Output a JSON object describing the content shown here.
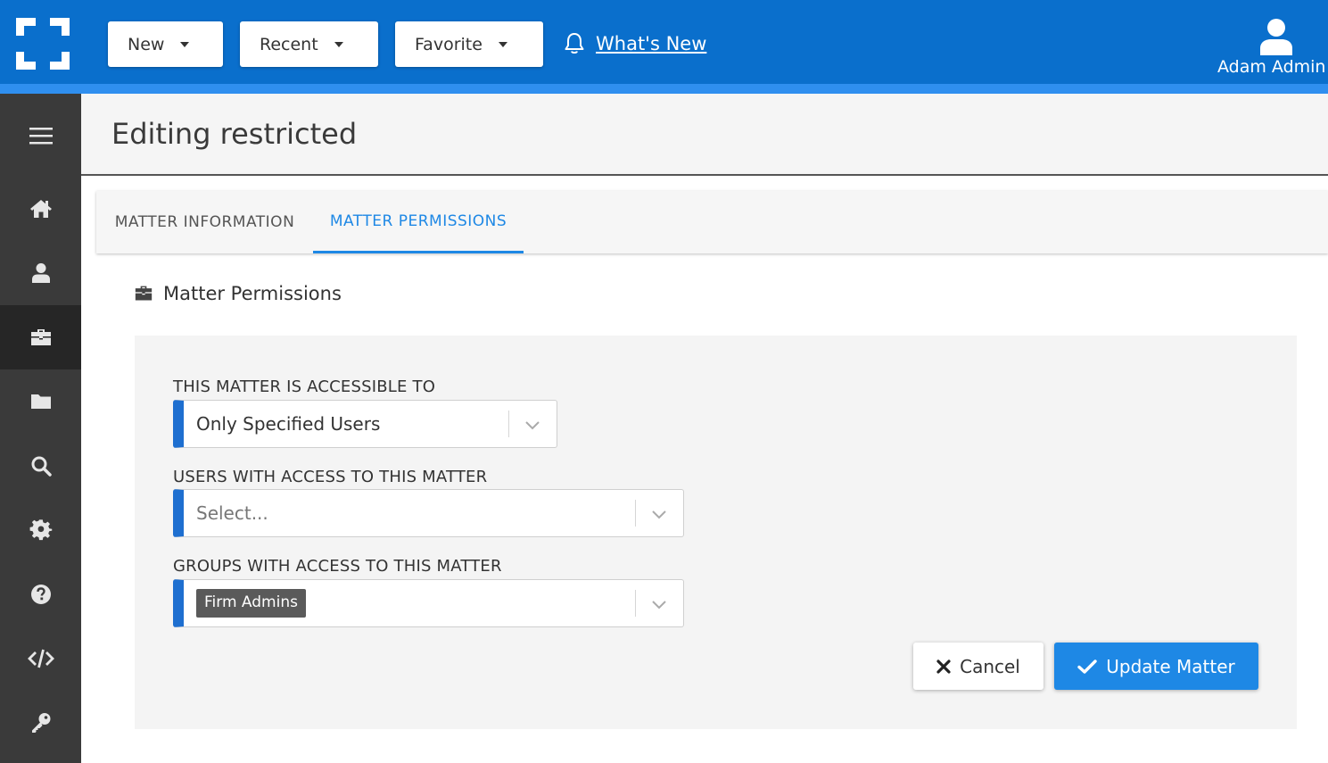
{
  "header": {
    "nav": [
      {
        "label": "New"
      },
      {
        "label": "Recent"
      },
      {
        "label": "Favorite"
      }
    ],
    "whats_new": "What's New",
    "user_name": "Adam Admin"
  },
  "sidebar": {
    "items": [
      {
        "icon": "hamburger-menu-icon"
      },
      {
        "icon": "home-icon"
      },
      {
        "icon": "user-icon"
      },
      {
        "icon": "briefcase-icon",
        "active": true
      },
      {
        "icon": "folder-icon"
      },
      {
        "icon": "search-icon"
      },
      {
        "icon": "gear-icon"
      },
      {
        "icon": "question-circle-icon"
      },
      {
        "icon": "code-icon"
      },
      {
        "icon": "key-icon"
      }
    ]
  },
  "page": {
    "title": "Editing restricted"
  },
  "tabs": [
    {
      "label": "MATTER INFORMATION",
      "active": false
    },
    {
      "label": "MATTER PERMISSIONS",
      "active": true
    }
  ],
  "section": {
    "title": "Matter Permissions"
  },
  "form": {
    "accessible_label": "THIS MATTER IS ACCESSIBLE TO",
    "accessible_value": "Only Specified Users",
    "users_label": "USERS WITH ACCESS TO THIS MATTER",
    "users_placeholder": "Select...",
    "groups_label": "GROUPS WITH ACCESS TO THIS MATTER",
    "groups_chips": [
      "Firm Admins"
    ]
  },
  "actions": {
    "cancel": "Cancel",
    "update": "Update Matter"
  },
  "colors": {
    "brand_blue": "#0a6fcc",
    "accent_blue": "#1e88e5",
    "sidebar": "#3a3a3a"
  }
}
